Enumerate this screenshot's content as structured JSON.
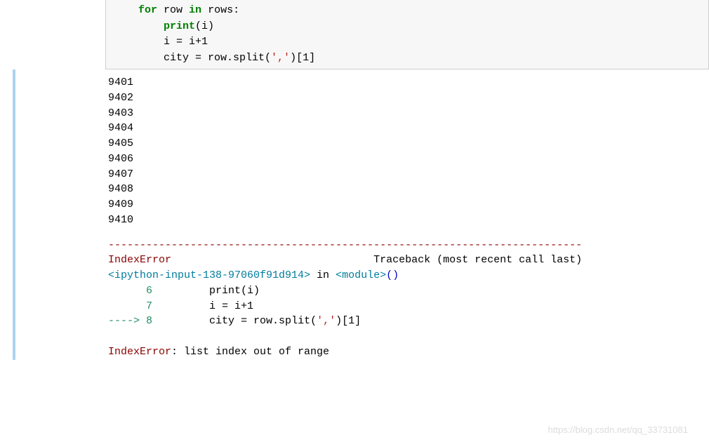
{
  "code": {
    "line1_indent": "    ",
    "line1_for": "for",
    "line1_mid": " row ",
    "line1_in": "in",
    "line1_rest": " rows:",
    "line2_indent": "        ",
    "line2_print": "print",
    "line2_args": "(i)",
    "line3": "        i = i+1",
    "line4_pre": "        city = row.split(",
    "line4_str": "','",
    "line4_post": ")[1]"
  },
  "output": {
    "numbers": [
      "9401",
      "9402",
      "9403",
      "9404",
      "9405",
      "9406",
      "9407",
      "9408",
      "9409",
      "9410"
    ]
  },
  "traceback": {
    "divider": "---------------------------------------------------------------------------",
    "error_name": "IndexError",
    "traceback_label": "Traceback (most recent call last)",
    "source_link": "<ipython-input-138-97060f91d914>",
    "in_text": " in ",
    "module_link": "<module>",
    "parens": "()",
    "ln6_num": "      6",
    "ln6_code": "         print(i)",
    "ln7_num": "      7",
    "ln7_code": "         i = i+1",
    "ln8_arrow": "----> ",
    "ln8_num": "8",
    "ln8_pre": "         city = row.split(",
    "ln8_str": "','",
    "ln8_post": ")[1]",
    "final_error": "IndexError",
    "final_msg": ": list index out of range"
  },
  "watermark": "https://blog.csdn.net/qq_33731081"
}
